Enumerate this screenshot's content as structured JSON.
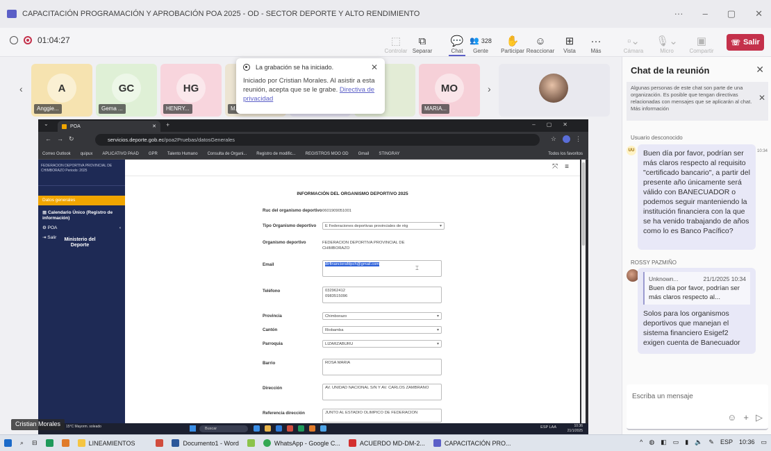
{
  "window": {
    "title": "CAPACITACIÓN PROGRAMACIÓN Y APROBACIÓN POA 2025 - OD - SECTOR DEPORTE Y ALTO RENDIMIENTO",
    "controls": [
      "···",
      "–",
      "▢",
      "✕"
    ]
  },
  "meeting": {
    "timer": "01:04:27",
    "toolbar": {
      "control": "Controlar",
      "separate": "Separar",
      "chat": "Chat",
      "people_count": "328",
      "people": "Gente",
      "participate": "Participar",
      "react": "Reaccionar",
      "view": "Vista",
      "more": "Más",
      "camera": "Cámara",
      "mic": "Micro",
      "share": "Compartir",
      "leave": "Salir"
    }
  },
  "participants": [
    {
      "initials": "A",
      "name": "Anggie...",
      "color": "#f6e3b0"
    },
    {
      "initials": "GC",
      "name": "Gema ...",
      "color": "#dff0d6"
    },
    {
      "initials": "HG",
      "name": "HENRY...",
      "color": "#f8d5dd"
    },
    {
      "initials": "",
      "name": "M...",
      "color": "#ece4d2"
    },
    {
      "initials": "",
      "name": "",
      "color": "#e4e2f1"
    },
    {
      "initials": "",
      "name": "",
      "color": "#e3ecd6"
    },
    {
      "initials": "MO",
      "name": "MARIA...",
      "color": "#f6d0d8"
    },
    {
      "initials": "",
      "name": "",
      "color": "#e9e9ef"
    }
  ],
  "recording_toast": {
    "title": "La grabación se ha iniciado.",
    "body": "Iniciado por Cristian Morales. Al asistir a esta reunión, acepta que se le grabe.",
    "link": "Directiva de privacidad"
  },
  "chat": {
    "title": "Chat de la reunión",
    "banner": "Algunas personas de este chat son parte de una organización. Es posible que tengan directivas relacionadas con mensajes que se aplicarán al chat. Más información",
    "messages": [
      {
        "sender": "Usuario desconocido",
        "avatar": "UU",
        "time": "10:34",
        "text": "Buen día por favor, podrían ser más claros respecto al requisito \"certificado bancario\", a partir del presente año únicamente será válido con BANECUADOR o podemos seguir manteniendo la institución financiera con la que se ha venido trabajando de años como lo es Banco Pacífico?"
      },
      {
        "sender": "ROSSY PAZMIÑO",
        "quote_author": "Unknown...",
        "quote_time": "21/1/2025 10:34",
        "quote_text": "Buen día por favor, podrían ser más claros respecto al...",
        "text": "Solos para los organismos deportivos que manejan el sistema financiero Esigef2 exigen cuenta de Banecuador"
      }
    ],
    "input_placeholder": "Escriba un mensaje"
  },
  "shared_browser": {
    "tab_title": "POA",
    "address": "servicios.deporte.gob.ec",
    "address_path": "/poa2Pruebas/datosGenerales",
    "bookmarks": [
      "Correo Outlook",
      "quipux",
      "APLICATIVO PAAD",
      "GPR",
      "Talento Humano",
      "Consulta de Organi...",
      "Registro de modific...",
      "REGISTROS MOO OD",
      "Gmail",
      "STINGRAY",
      "Todos los favoritos"
    ],
    "sidebar": {
      "org": "FEDERACION DEPORTIVA PROVINCIAL DE CHIMBORAZO Periodo: 2025",
      "items": [
        "Datos generales",
        "Calendario Único (Registro de información)",
        "POA",
        "Salir"
      ],
      "ministry": "Ministerio del Deporte"
    },
    "form": {
      "heading": "INFORMACIÓN DEL ORGANISMO DEPORTIVO 2025",
      "fields": [
        {
          "label": "Ruc del organismo deportivo",
          "value": "0601909051001"
        },
        {
          "label": "Tipo Organismo deportivo",
          "value": "E Federaciones deportivas provinciales de rég"
        },
        {
          "label": "Organismo deportivo",
          "value": "FEDERACION DEPORTIVA PROVINCIAL DE CHIMBORAZO"
        },
        {
          "label": "Email",
          "value": "dirfinancierafdpch@gmail.com"
        },
        {
          "label": "Teléfono",
          "value": "032962412\n0983515096"
        },
        {
          "label": "Provincia",
          "value": "Chimborazo"
        },
        {
          "label": "Cantón",
          "value": "Riobamba"
        },
        {
          "label": "Parroquia",
          "value": "LIZARZABURU"
        },
        {
          "label": "Barrio",
          "value": "ROSA MARIA"
        },
        {
          "label": "Dirección",
          "value": "AV. UNIDAD NACIONAL S/N Y AV. CARLOS ZAMBRANO"
        },
        {
          "label": "Referencia dirección",
          "value": "JUNTO AL ESTADIO OLIMPICO DE FEDERACION"
        }
      ]
    },
    "inner_taskbar": {
      "weather": "15°C Mayorm. soleado",
      "search": "Buscar",
      "lang": "ESP LAA",
      "time": "10:36",
      "date": "21/1/2025"
    }
  },
  "presenter": "Cristian Morales",
  "taskbar": {
    "apps": [
      "LINEAMIENTOS",
      "Documento1 - Word",
      "WhatsApp - Google C...",
      "ACUERDO MD-DM-2...",
      "CAPACITACIÓN PRO..."
    ],
    "lang": "ESP",
    "time": "10:36"
  }
}
